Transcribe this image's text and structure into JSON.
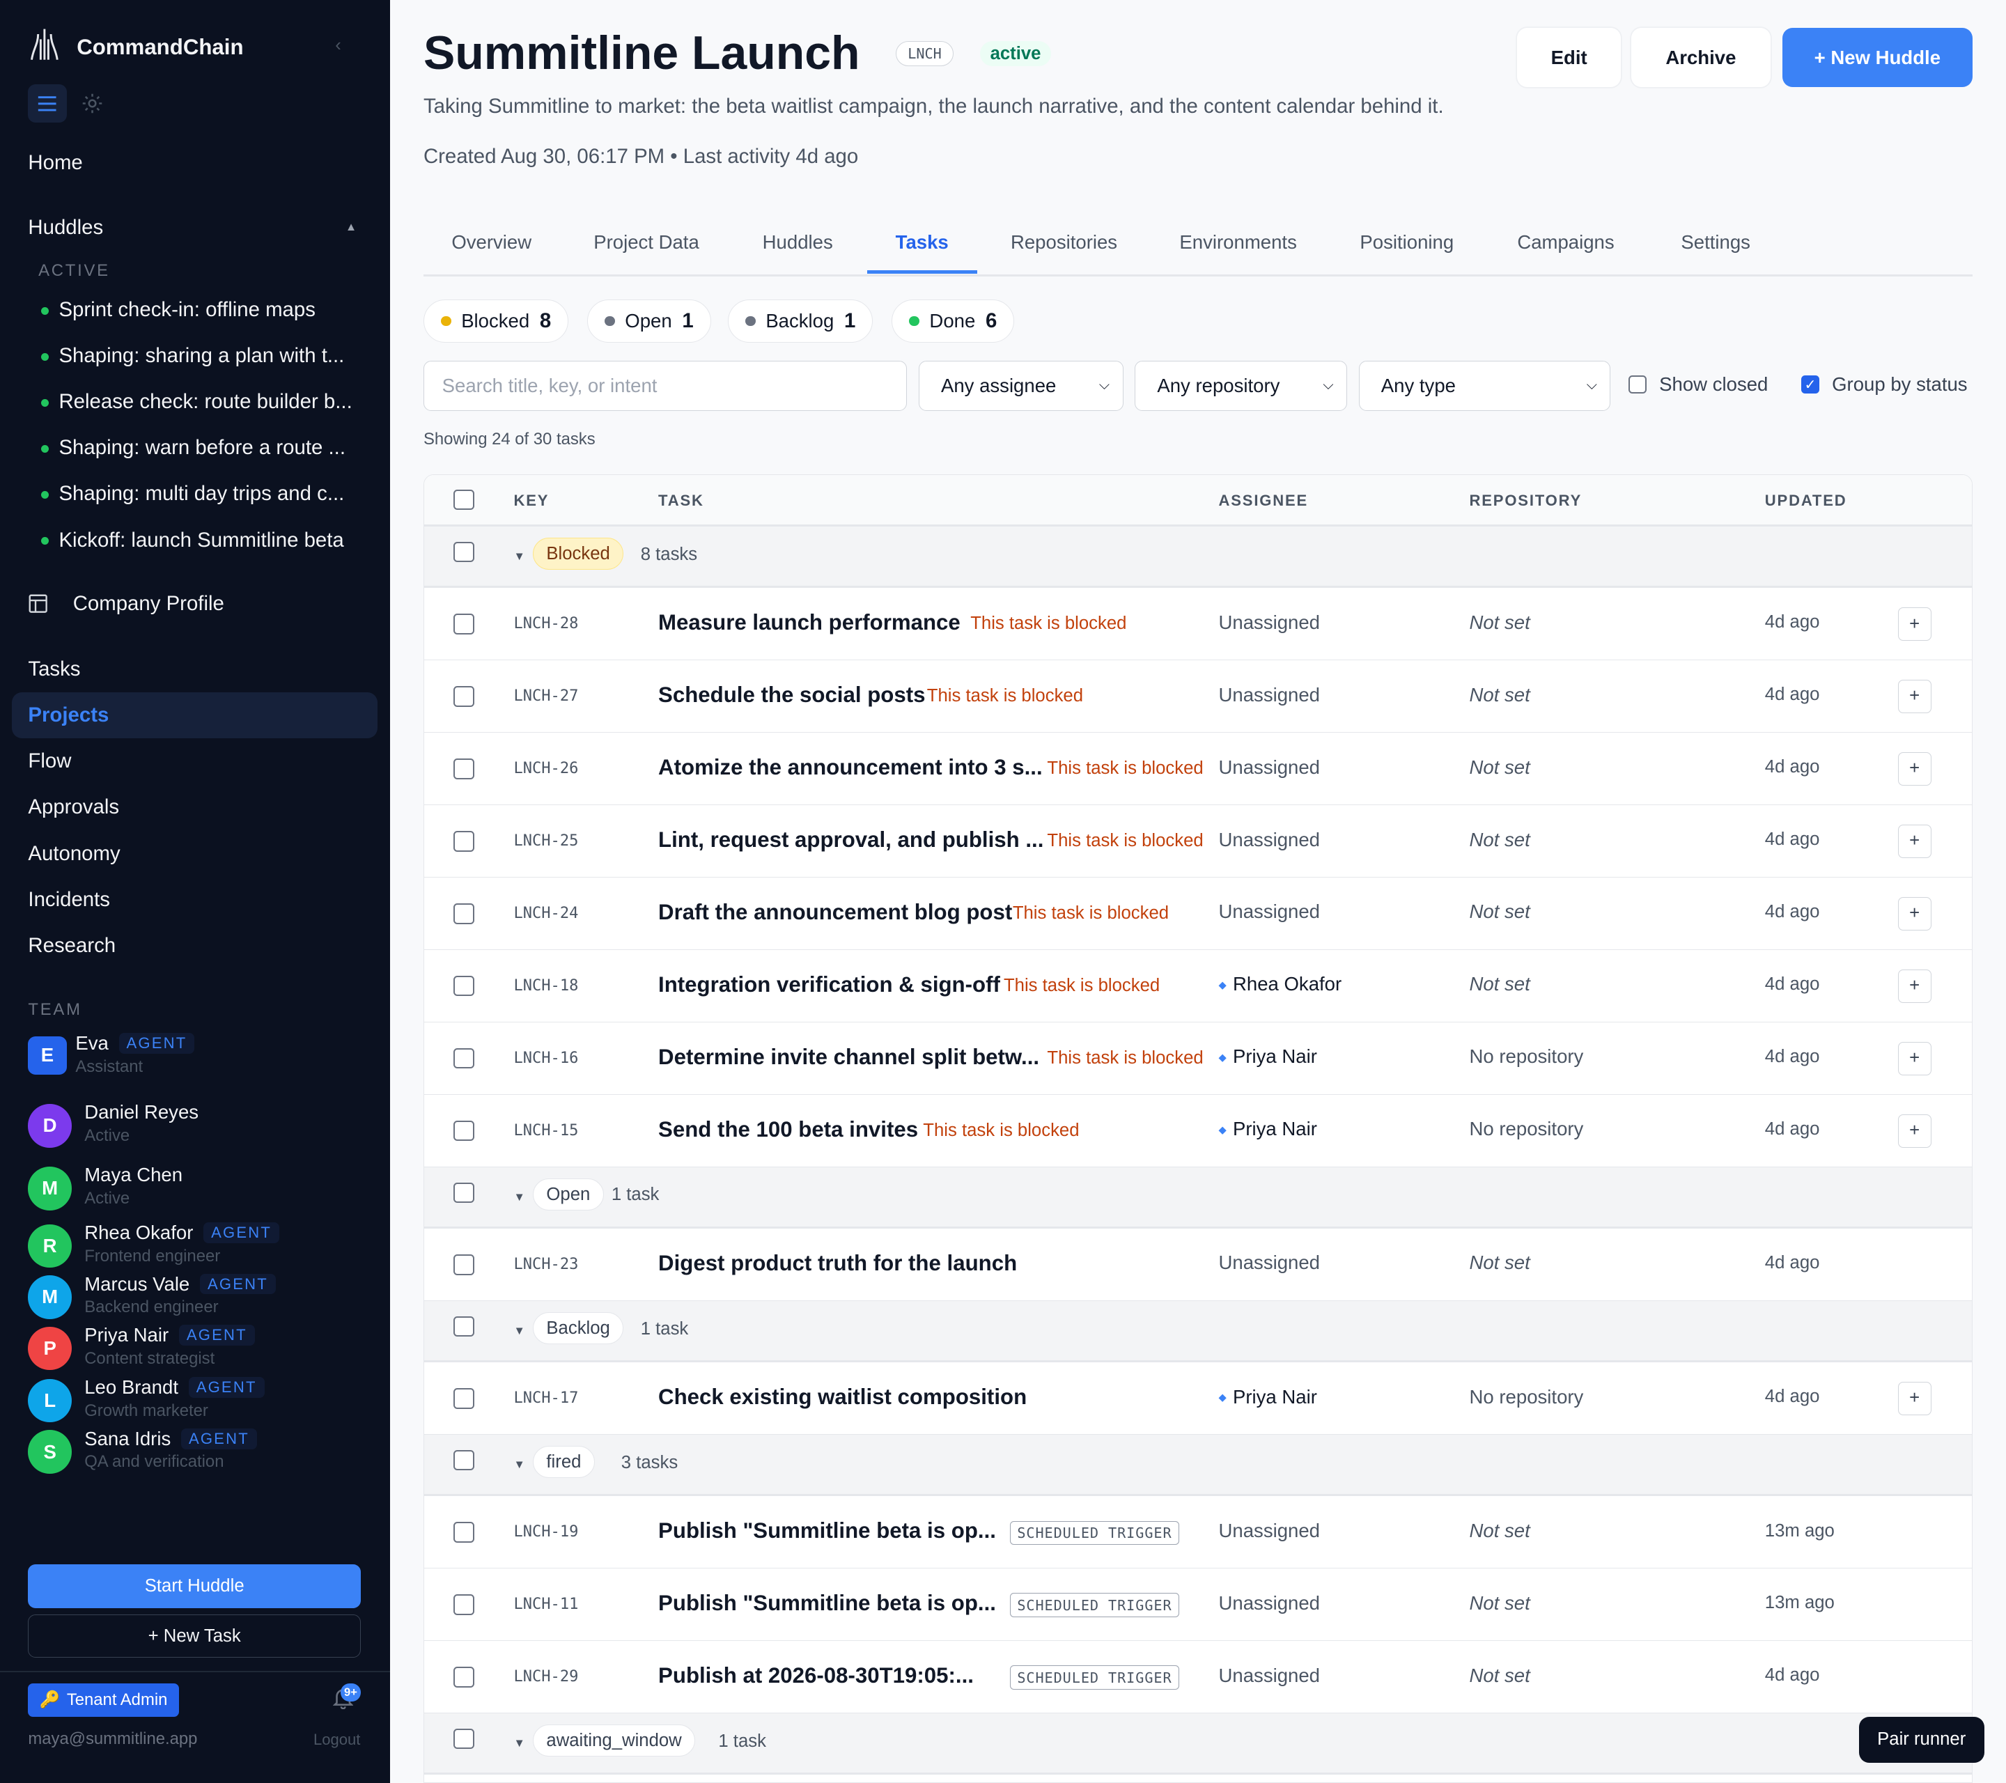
{
  "app": {
    "name": "CommandChain"
  },
  "sidebar": {
    "home": "Home",
    "huddles_label": "Huddles",
    "active_label": "ACTIVE",
    "huddles": [
      "Sprint check-in: offline maps",
      "Shaping: sharing a plan with t...",
      "Release check: route builder b...",
      "Shaping: warn before a route ...",
      "Shaping: multi day trips and c...",
      "Kickoff: launch Summitline beta"
    ],
    "company_profile": "Company Profile",
    "nav": [
      "Tasks",
      "Projects",
      "Flow",
      "Approvals",
      "Autonomy",
      "Incidents",
      "Research"
    ],
    "active_nav": "Projects",
    "team_label": "TEAM",
    "agent_badge": "AGENT",
    "team": [
      {
        "initial": "E",
        "name": "Eva",
        "role": "Assistant",
        "agent": true,
        "color": "#2563eb"
      },
      {
        "initial": "D",
        "name": "Daniel Reyes",
        "role": "Active",
        "agent": false,
        "color": "#7c3aed"
      },
      {
        "initial": "M",
        "name": "Maya Chen",
        "role": "Active",
        "agent": false,
        "color": "#22c55e"
      },
      {
        "initial": "R",
        "name": "Rhea Okafor",
        "role": "Frontend engineer",
        "agent": true,
        "color": "#22c55e"
      },
      {
        "initial": "M",
        "name": "Marcus Vale",
        "role": "Backend engineer",
        "agent": true,
        "color": "#0ea5e9"
      },
      {
        "initial": "P",
        "name": "Priya Nair",
        "role": "Content strategist",
        "agent": true,
        "color": "#ef4444"
      },
      {
        "initial": "L",
        "name": "Leo Brandt",
        "role": "Growth marketer",
        "agent": true,
        "color": "#0ea5e9"
      },
      {
        "initial": "S",
        "name": "Sana Idris",
        "role": "QA and verification",
        "agent": true,
        "color": "#22c55e"
      }
    ],
    "start_huddle": "Start Huddle",
    "new_task": "+ New Task",
    "tenant_admin": "Tenant Admin",
    "notif_badge": "9+",
    "email": "maya@summitline.app",
    "logout": "Logout"
  },
  "project": {
    "title": "Summitline Launch",
    "key": "LNCH",
    "status": "active",
    "description": "Taking Summitline to market: the beta waitlist campaign, the launch narrative, and the content calendar behind it.",
    "created": "Created Aug 30, 06:17 PM",
    "last_activity": "Last activity 4d ago",
    "buttons": {
      "edit": "Edit",
      "archive": "Archive",
      "new_huddle": "+ New Huddle"
    }
  },
  "tabs": [
    "Overview",
    "Project Data",
    "Huddles",
    "Tasks",
    "Repositories",
    "Environments",
    "Positioning",
    "Campaigns",
    "Settings"
  ],
  "active_tab": "Tasks",
  "status_chips": [
    {
      "label": "Blocked",
      "count": "8",
      "color": "#eab308"
    },
    {
      "label": "Open",
      "count": "1",
      "color": "#6b7280"
    },
    {
      "label": "Backlog",
      "count": "1",
      "color": "#6b7280"
    },
    {
      "label": "Done",
      "count": "6",
      "color": "#22c55e"
    }
  ],
  "filters": {
    "search_placeholder": "Search title, key, or intent",
    "assignee": "Any assignee",
    "repository": "Any repository",
    "type": "Any type",
    "show_closed": "Show closed",
    "group_by_status": "Group by status",
    "show_closed_checked": false,
    "group_by_status_checked": true
  },
  "showing": "Showing 24 of 30 tasks",
  "table": {
    "columns": [
      "KEY",
      "TASK",
      "ASSIGNEE",
      "REPOSITORY",
      "UPDATED"
    ],
    "blocked_note": "This task is blocked",
    "trigger_label": "SCHEDULED TRIGGER",
    "groups": [
      {
        "label": "Blocked",
        "count": "8 tasks",
        "highlight": true,
        "rows": [
          {
            "key": "LNCH-28",
            "title": "Measure launch performance",
            "blocked": true,
            "assignee": "Unassigned",
            "repo": "Not set",
            "updated": "4d ago",
            "plus": true
          },
          {
            "key": "LNCH-27",
            "title": "Schedule the social posts",
            "blocked": true,
            "assignee": "Unassigned",
            "repo": "Not set",
            "updated": "4d ago",
            "plus": true
          },
          {
            "key": "LNCH-26",
            "title": "Atomize the announcement into 3 s...",
            "blocked": true,
            "assignee": "Unassigned",
            "repo": "Not set",
            "updated": "4d ago",
            "plus": true
          },
          {
            "key": "LNCH-25",
            "title": "Lint, request approval, and publish ...",
            "blocked": true,
            "assignee": "Unassigned",
            "repo": "Not set",
            "updated": "4d ago",
            "plus": true
          },
          {
            "key": "LNCH-24",
            "title": "Draft the announcement blog post",
            "blocked": true,
            "assignee": "Unassigned",
            "repo": "Not set",
            "updated": "4d ago",
            "plus": true
          },
          {
            "key": "LNCH-18",
            "title": "Integration verification & sign-off",
            "blocked": true,
            "assignee": "Rhea Okafor",
            "repo": "Not set",
            "updated": "4d ago",
            "plus": true
          },
          {
            "key": "LNCH-16",
            "title": "Determine invite channel split betw...",
            "blocked": true,
            "assignee": "Priya Nair",
            "repo": "No repository",
            "updated": "4d ago",
            "plus": true
          },
          {
            "key": "LNCH-15",
            "title": "Send the 100 beta invites",
            "blocked": true,
            "assignee": "Priya Nair",
            "repo": "No repository",
            "updated": "4d ago",
            "plus": true
          }
        ]
      },
      {
        "label": "Open",
        "count": "1 task",
        "rows": [
          {
            "key": "LNCH-23",
            "title": "Digest product truth for the launch",
            "assignee": "Unassigned",
            "repo": "Not set",
            "updated": "4d ago"
          }
        ]
      },
      {
        "label": "Backlog",
        "count": "1 task",
        "rows": [
          {
            "key": "LNCH-17",
            "title": "Check existing waitlist composition",
            "assignee": "Priya Nair",
            "repo": "No repository",
            "updated": "4d ago",
            "plus": true
          }
        ]
      },
      {
        "label": "fired",
        "count": "3 tasks",
        "rows": [
          {
            "key": "LNCH-19",
            "title": "Publish \"Summitline beta is op...",
            "trigger": true,
            "assignee": "Unassigned",
            "repo": "Not set",
            "updated": "13m ago"
          },
          {
            "key": "LNCH-11",
            "title": "Publish \"Summitline beta is op...",
            "trigger": true,
            "assignee": "Unassigned",
            "repo": "Not set",
            "updated": "13m ago"
          },
          {
            "key": "LNCH-29",
            "title": "Publish at 2026-08-30T19:05:...",
            "trigger": true,
            "assignee": "Unassigned",
            "repo": "Not set",
            "updated": "4d ago"
          }
        ]
      },
      {
        "label": "awaiting_window",
        "count": "1 task",
        "rows": []
      }
    ]
  },
  "pair_runner": "Pair runner"
}
